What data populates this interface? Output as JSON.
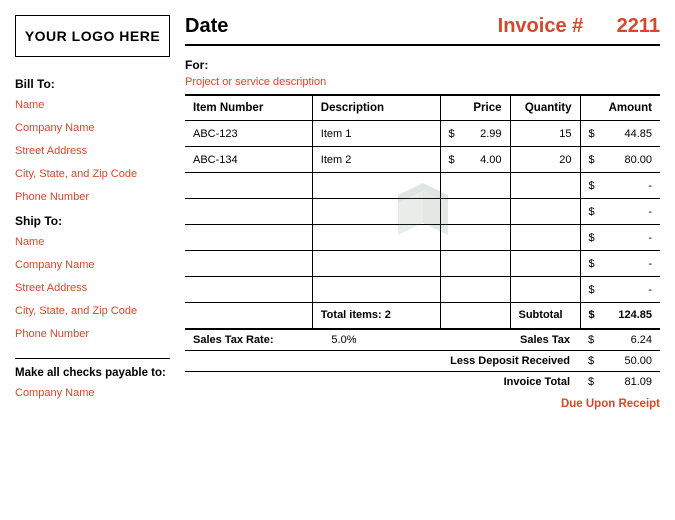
{
  "logo_text": "YOUR LOGO HERE",
  "date_label": "Date",
  "invoice_label": "Invoice #",
  "invoice_number": "2211",
  "bill_to": {
    "heading": "Bill To:",
    "fields": [
      "Name",
      "Company Name",
      "Street Address",
      "City, State, and Zip Code",
      "Phone Number"
    ]
  },
  "ship_to": {
    "heading": "Ship To:",
    "fields": [
      "Name",
      "Company Name",
      "Street Address",
      "City, State, and Zip Code",
      "Phone Number"
    ]
  },
  "checks_payable": {
    "label": "Make all checks payable to:",
    "value": "Company Name"
  },
  "for": {
    "label": "For:",
    "desc": "Project or service description"
  },
  "columns": {
    "item_number": "Item Number",
    "description": "Description",
    "price": "Price",
    "quantity": "Quantity",
    "amount": "Amount"
  },
  "currency": "$",
  "items": [
    {
      "item_number": "ABC-123",
      "description": "Item 1",
      "price": "2.99",
      "quantity": "15",
      "amount": "44.85"
    },
    {
      "item_number": "ABC-134",
      "description": "Item 2",
      "price": "4.00",
      "quantity": "20",
      "amount": "80.00"
    }
  ],
  "empty_rows": 5,
  "totals_row": {
    "total_items_label": "Total items: 2",
    "subtotal_label": "Subtotal",
    "subtotal_value": "124.85"
  },
  "summary": {
    "tax_rate_label": "Sales Tax Rate:",
    "tax_rate_value": "5.0%",
    "sales_tax_label": "Sales Tax",
    "sales_tax_value": "6.24",
    "less_deposit_label": "Less Deposit Received",
    "less_deposit_value": "50.00",
    "invoice_total_label": "Invoice Total",
    "invoice_total_value": "81.09"
  },
  "due_note": "Due Upon Receipt"
}
